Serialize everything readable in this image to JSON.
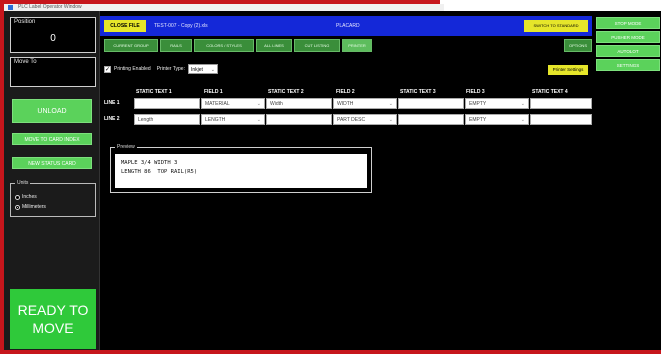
{
  "window": {
    "title": "PLC Label Operator Window"
  },
  "left": {
    "position_label": "Position",
    "position_value": "0",
    "move_to_label": "Move To",
    "move_to_value": "",
    "unload_label": "UNLOAD",
    "btn_move_label": "MOVE TO CARD INDEX",
    "btn_sync_label": "NEW STATUS CARD",
    "units_legend": "Units",
    "units_options": [
      "Inches",
      "Millimeters"
    ],
    "units_selected": "Millimeters",
    "ready_line1": "READY TO",
    "ready_line2": "MOVE"
  },
  "topbar": {
    "close_label": "CLOSE FILE",
    "filename": "TEST-007 - Copy (2).xls",
    "status": "PLACARD",
    "switch_label": "SWITCH TO STANDARD"
  },
  "tabs": [
    {
      "label": "CURRENT GROUP",
      "active": false
    },
    {
      "label": "RAILS",
      "active": false
    },
    {
      "label": "COLORS / STYLES",
      "active": false
    },
    {
      "label": "ALL LINES",
      "active": false
    },
    {
      "label": "CUT LISTING",
      "active": false
    },
    {
      "label": "PRINTER",
      "active": true
    }
  ],
  "options_label": "OPTIONS",
  "right_buttons": [
    "STOP MODE",
    "PUSHER MODE",
    "AUTOLOT",
    "SETTINGS"
  ],
  "printing": {
    "enabled": true,
    "enabled_label": "Printing Enabled",
    "type_label": "Printer Type:",
    "type_value": "Inkjet",
    "settings_label": "Printer Settings"
  },
  "grid": {
    "headers": [
      "STATIC TEXT 1",
      "FIELD 1",
      "STATIC TEXT 2",
      "FIELD 2",
      "STATIC TEXT 3",
      "FIELD 3",
      "STATIC TEXT 4"
    ],
    "lines": [
      {
        "label": "LINE 1",
        "cells": [
          "",
          "MATERIAL",
          "Width",
          "WIDTH",
          "",
          "EMPTY",
          ""
        ]
      },
      {
        "label": "LINE 2",
        "cells": [
          "Length",
          "LENGTH",
          "",
          "PART DESC",
          "",
          "EMPTY",
          ""
        ]
      }
    ]
  },
  "preview": {
    "legend": "Preview",
    "line1": "MAPLE 3/4 WIDTH 3",
    "line2": "LENGTH 86  TOP RAIL(R5)"
  }
}
